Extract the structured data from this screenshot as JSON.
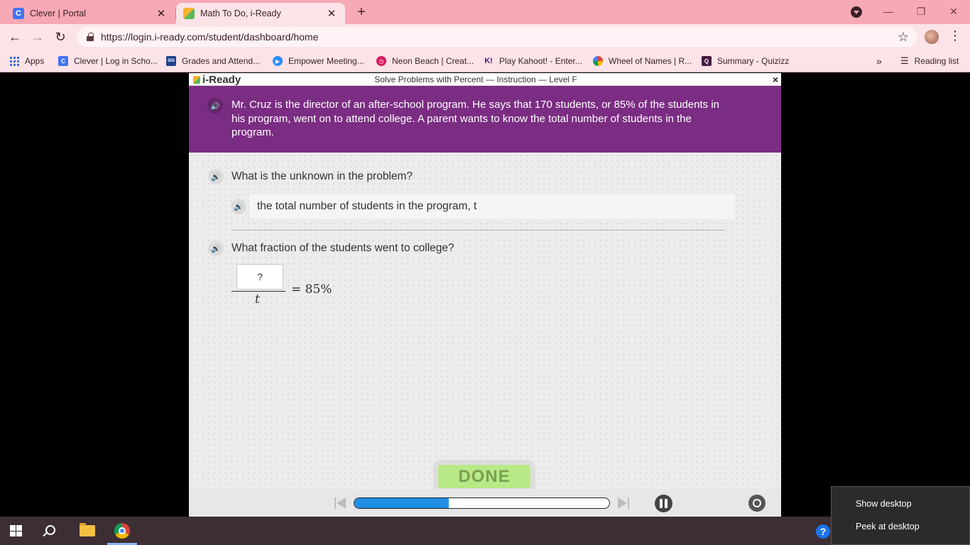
{
  "browser": {
    "tabs": [
      {
        "title": "Clever | Portal",
        "favicon_letter": "C",
        "favicon_color": "#4274f6"
      },
      {
        "title": "Math To Do, i-Ready",
        "favicon_color": "#f7b22b"
      }
    ],
    "new_tab": "+",
    "url": "https://login.i-ready.com/student/dashboard/home"
  },
  "bookmarks": [
    {
      "label": "Apps",
      "icon": "apps-grid-icon"
    },
    {
      "label": "Clever | Log in Scho...",
      "icon_text": "C",
      "color": "#4274f6"
    },
    {
      "label": "Grades and Attend...",
      "icon_text": "SIS",
      "color": "#1f3f8f"
    },
    {
      "label": "Empower Meeting...",
      "icon_text": "▶",
      "color": "#2d8cff"
    },
    {
      "label": "Neon Beach | Creat...",
      "icon_text": "◷",
      "color": "#d81b60"
    },
    {
      "label": "Play Kahoot! - Enter...",
      "icon_text": "K!",
      "color": "#46178f"
    },
    {
      "label": "Wheel of Names | R...",
      "icon_text": "●",
      "color": "#e69100"
    },
    {
      "label": "Summary - Quizizz",
      "icon_text": "Q",
      "color": "#461a42"
    }
  ],
  "bookmarks_more": "»",
  "reading_list": "Reading list",
  "lesson": {
    "logo": "i-Ready",
    "title": "Solve Problems with Percent — Instruction — Level F",
    "close": "×",
    "prompt": "Mr. Cruz is the director of an after-school program. He says that 170 students, or 85% of the students in his program, went on to attend college. A parent wants to know the total number of students in the program.",
    "question1": "What is the unknown in the problem?",
    "answer1": "the total number of students in the program, t",
    "question2": "What fraction of the students went to college?",
    "fraction": {
      "numerator": "?",
      "denominator": "t",
      "equals": "= 85%"
    },
    "done_label": "DONE",
    "progress": 0.37,
    "accent": "#7b2d83"
  },
  "desktop_menu": {
    "show_desktop": "Show desktop",
    "peek_desktop": "Peek at desktop"
  },
  "taskbar": {
    "help": "?"
  }
}
